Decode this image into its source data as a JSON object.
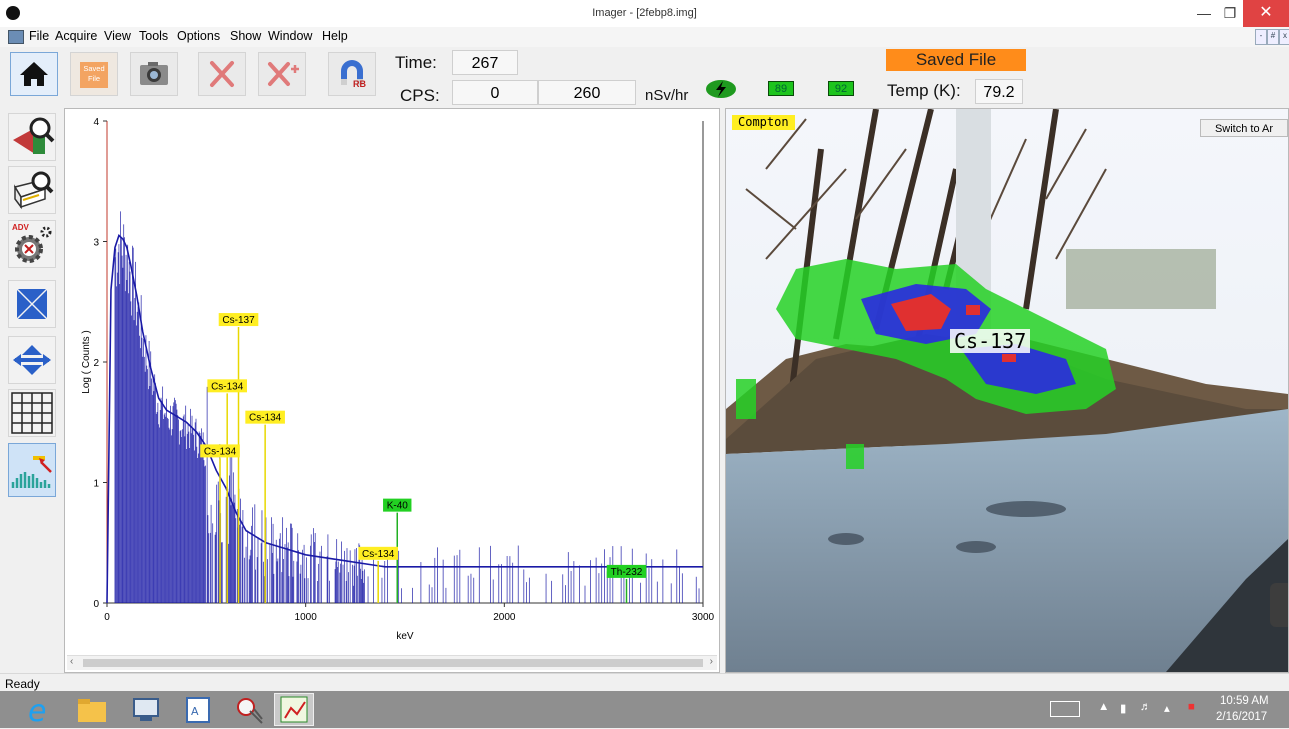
{
  "window": {
    "title": "Imager - [2febp8.img]"
  },
  "menu": [
    "File",
    "Acquire",
    "View",
    "Tools",
    "Options",
    "Show",
    "Window",
    "Help"
  ],
  "toolbar": {
    "saved_file_btn": "Saved\nFile",
    "reset_btn_badge": "RB",
    "time_label": "Time:",
    "time_value": "267",
    "cps_label": "CPS:",
    "cps_value": "0",
    "dose_value": "260",
    "dose_unit": "nSv/hr",
    "saved_file_banner": "Saved File",
    "battery1": "89",
    "battery2": "92",
    "temp_label": "Temp (K):",
    "temp_value": "79.2"
  },
  "sidebar": {
    "adv_badge": "ADV"
  },
  "spectrum": {
    "ylabel": "Log ( Counts )",
    "xlabel": "keV",
    "y_ticks": [
      "0",
      "1",
      "2",
      "3",
      "4"
    ],
    "x_ticks": [
      "0",
      "1000",
      "2000",
      "3000"
    ],
    "markers": [
      {
        "label": "Cs-137",
        "kev": 662,
        "top": 2.29,
        "color": "yellow"
      },
      {
        "label": "Cs-134",
        "kev": 605,
        "top": 1.74,
        "color": "yellow"
      },
      {
        "label": "Cs-134",
        "kev": 796,
        "top": 1.48,
        "color": "yellow"
      },
      {
        "label": "Cs-134",
        "kev": 569,
        "top": 1.2,
        "color": "yellow"
      },
      {
        "label": "K-40",
        "kev": 1461,
        "top": 0.75,
        "color": "green"
      },
      {
        "label": "Cs-134",
        "kev": 1365,
        "top": 0.35,
        "color": "yellow"
      },
      {
        "label": "Th-232",
        "kev": 2615,
        "top": 0.2,
        "color": "green"
      }
    ]
  },
  "chart_data": {
    "type": "line",
    "xlabel": "keV",
    "ylabel": "Log ( Counts )",
    "xlim": [
      0,
      3000
    ],
    "ylim": [
      0,
      4
    ],
    "x": [
      0,
      20,
      40,
      60,
      80,
      100,
      120,
      150,
      180,
      220,
      260,
      300,
      350,
      400,
      450,
      500,
      550,
      600,
      650,
      700,
      800,
      900,
      1000,
      1200,
      1400,
      1600,
      2000,
      2500,
      3000
    ],
    "y": [
      0,
      2.6,
      2.95,
      3.05,
      3.02,
      2.95,
      2.8,
      2.55,
      2.25,
      1.95,
      1.7,
      1.6,
      1.55,
      1.5,
      1.42,
      1.3,
      1.1,
      0.95,
      0.75,
      0.6,
      0.5,
      0.45,
      0.4,
      0.35,
      0.3,
      0.3,
      0.3,
      0.3,
      0.3
    ]
  },
  "image_view": {
    "mode_label": "Compton",
    "switch_button": "Switch to Ar",
    "hotspot_label": "Cs-137"
  },
  "status": {
    "text": "Ready"
  },
  "tray": {
    "time": "10:59 AM",
    "date": "2/16/2017"
  }
}
